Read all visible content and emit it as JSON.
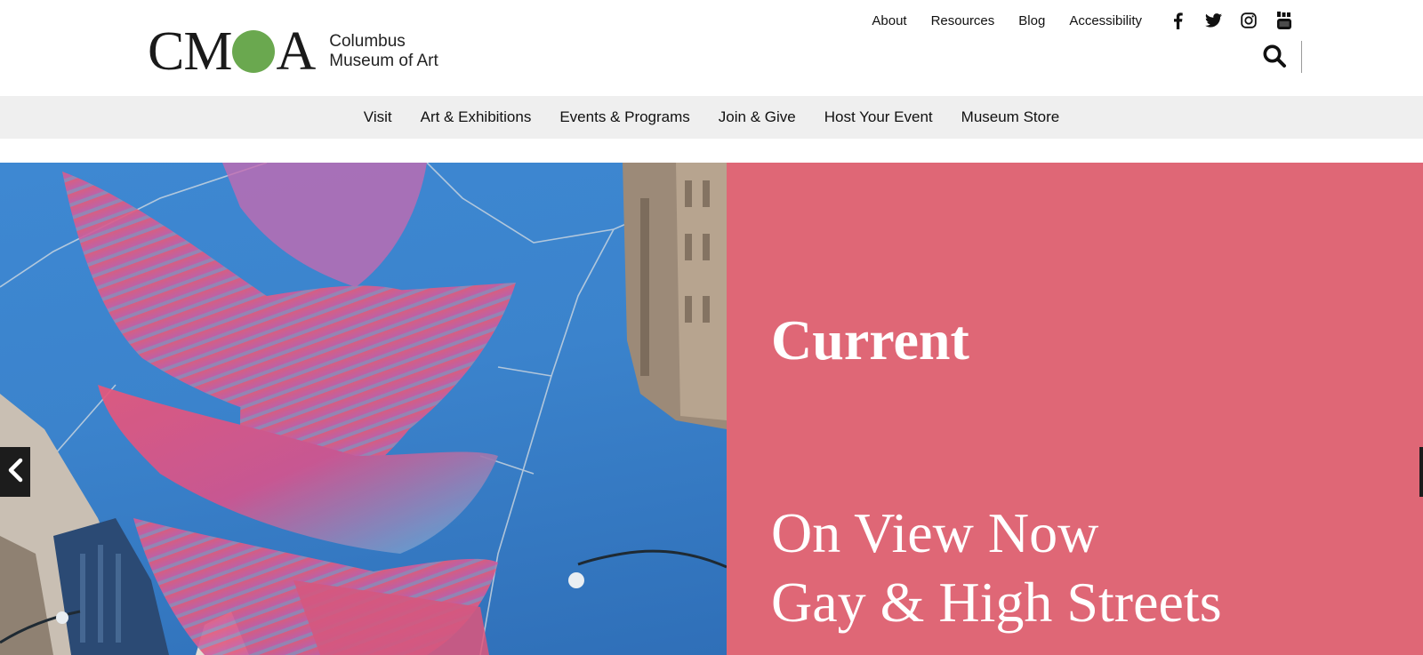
{
  "logo": {
    "mark_left": "CM",
    "mark_right": "A",
    "line1": "Columbus",
    "line2": "Museum of Art",
    "dot_color": "#6aa84f"
  },
  "utility_nav": {
    "links": [
      "About",
      "Resources",
      "Blog",
      "Accessibility"
    ],
    "social": [
      "facebook-icon",
      "twitter-icon",
      "instagram-icon",
      "youtube-icon"
    ]
  },
  "search": {
    "icon": "search-icon"
  },
  "main_nav": {
    "items": [
      "Visit",
      "Art & Exhibitions",
      "Events & Programs",
      "Join & Give",
      "Host Your Event",
      "Museum Store"
    ]
  },
  "hero": {
    "title": "Current",
    "subtitle_line1": "On View Now",
    "subtitle_line2": "Gay & High Streets",
    "panel_color": "#df6776",
    "prev_icon": "chevron-left-icon"
  }
}
